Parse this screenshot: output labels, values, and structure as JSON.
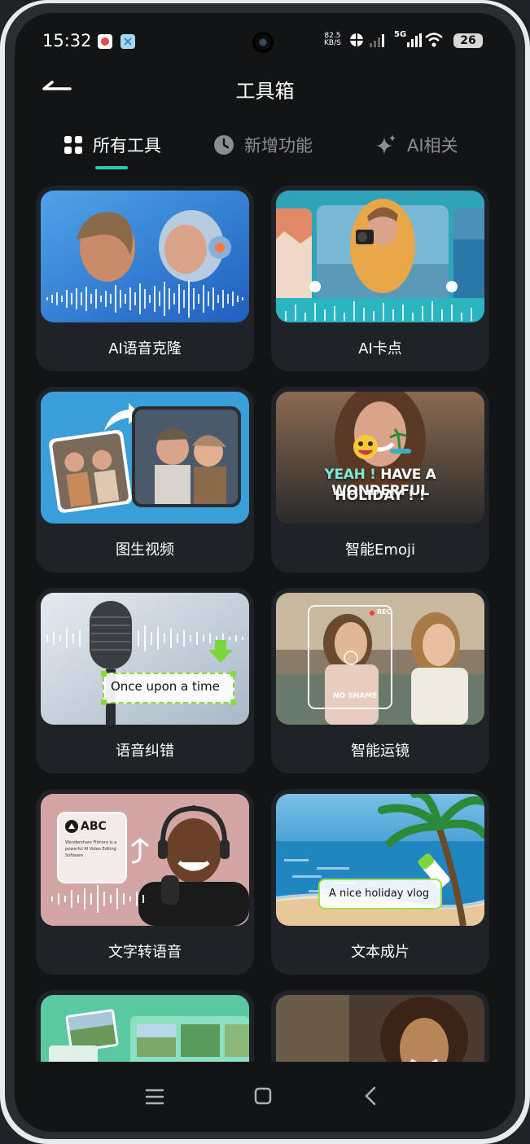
{
  "status_bar": {
    "time": "15:32",
    "net_speed_value": "82.5",
    "net_speed_unit": "KB/S",
    "network_type": "5G",
    "battery": "26"
  },
  "header": {
    "title": "工具箱"
  },
  "tabs": [
    {
      "label": "所有工具",
      "icon": "grid-icon",
      "active": true
    },
    {
      "label": "新增功能",
      "icon": "clock-icon",
      "active": false
    },
    {
      "label": "AI相关",
      "icon": "sparkle-icon",
      "active": false
    }
  ],
  "tools": [
    {
      "label": "AI语音克隆"
    },
    {
      "label": "AI卡点"
    },
    {
      "label": "图生视频"
    },
    {
      "label": "智能Emoji",
      "overlay_line1_a": "YEAH !",
      "overlay_line1_b": "HAVE A",
      "overlay_line1_c": "WONDERFUL",
      "overlay_line2": "HOLIDAY ! !"
    },
    {
      "label": "语音纠错",
      "overlay_text": "Once upon a time"
    },
    {
      "label": "智能运镜",
      "overlay_rec": "REC",
      "overlay_caption": "NO SHAME"
    },
    {
      "label": "文字转语音",
      "overlay_title": "ABC",
      "overlay_line1": "Wondershare Filmora is a",
      "overlay_line2": "powerful AI Video Editing",
      "overlay_line3": "Software ."
    },
    {
      "label": "文本成片",
      "overlay_text": "A nice holiday vlog"
    },
    {
      "label": ""
    },
    {
      "label": ""
    }
  ],
  "colors": {
    "accent": "#19d3b4",
    "background": "#121416",
    "card": "#1f2226"
  }
}
